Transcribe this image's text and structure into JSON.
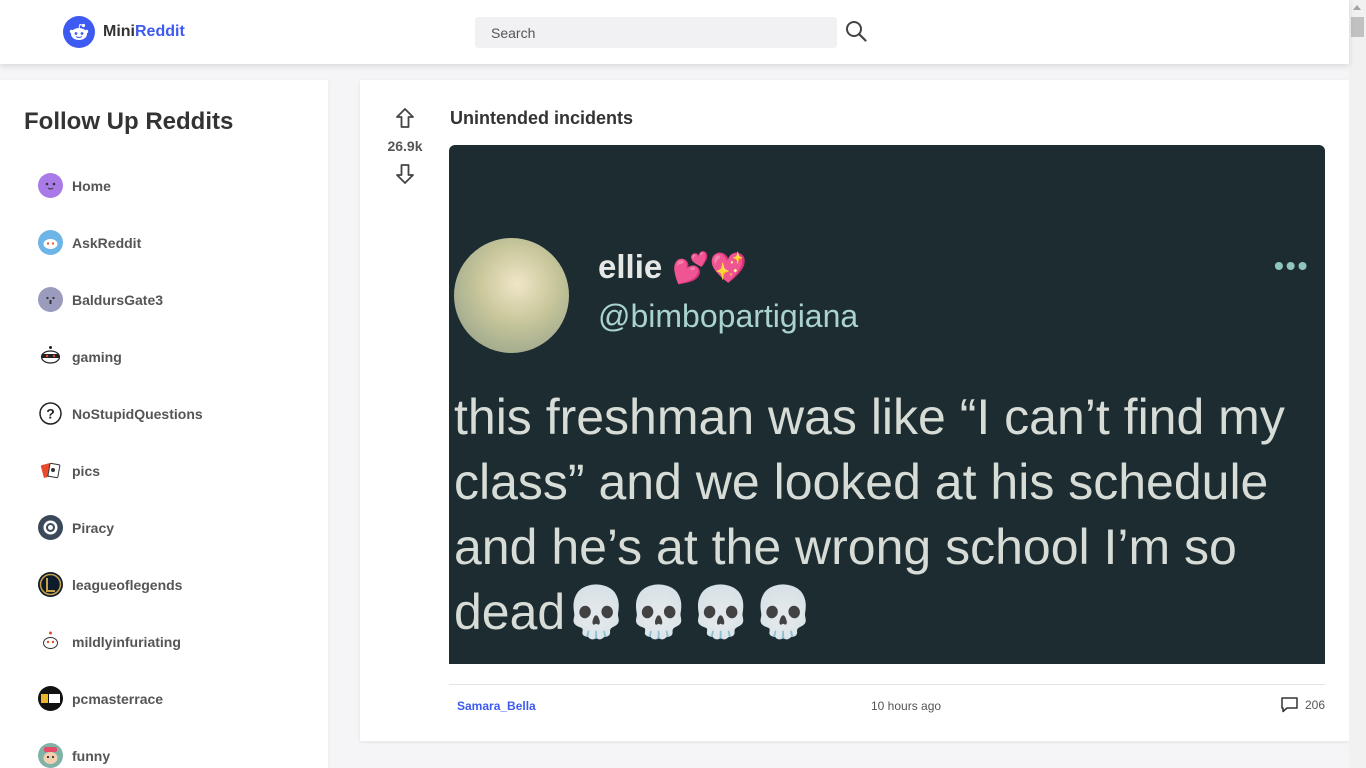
{
  "header": {
    "logo_prefix": "Mini",
    "logo_accent": "Reddit",
    "search_placeholder": "Search",
    "accent_color": "#3d5af1"
  },
  "sidebar": {
    "title": "Follow Up Reddits",
    "items": [
      {
        "label": "Home",
        "icon": "home-avatar-icon",
        "color": "#a87be8"
      },
      {
        "label": "AskReddit",
        "icon": "askreddit-avatar-icon",
        "color": "#6db5e6"
      },
      {
        "label": "BaldursGate3",
        "icon": "baldursgate3-avatar-icon",
        "color": "#9b9bbd"
      },
      {
        "label": "gaming",
        "icon": "gaming-avatar-icon",
        "color": "#ffffff"
      },
      {
        "label": "NoStupidQuestions",
        "icon": "question-mark-icon",
        "color": "#ffffff"
      },
      {
        "label": "pics",
        "icon": "pics-avatar-icon",
        "color": "#ffffff"
      },
      {
        "label": "Piracy",
        "icon": "piracy-avatar-icon",
        "color": "#3b4a5a"
      },
      {
        "label": "leagueoflegends",
        "icon": "leagueoflegends-avatar-icon",
        "color": "#0d1b2a"
      },
      {
        "label": "mildlyinfuriating",
        "icon": "mildlyinfuriating-avatar-icon",
        "color": "#ffffff"
      },
      {
        "label": "pcmasterrace",
        "icon": "pcmasterrace-avatar-icon",
        "color": "#111111"
      },
      {
        "label": "funny",
        "icon": "funny-avatar-icon",
        "color": "#7fb3a8"
      }
    ]
  },
  "post": {
    "score": "26.9k",
    "title": "Unintended incidents",
    "image": {
      "tweet_name": "ellie",
      "tweet_emoji": "💕💖",
      "tweet_handle": "@bimbopartigiana",
      "tweet_text": "this freshman was like “I can’t find my class” and we looked at his schedule and he’s at the wrong school I’m so dead💀💀💀💀"
    },
    "author": "Samara_Bella",
    "time": "10 hours ago",
    "comments": "206"
  }
}
